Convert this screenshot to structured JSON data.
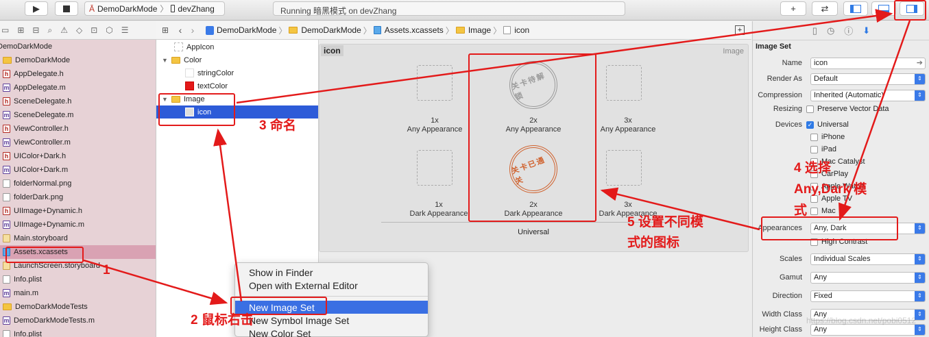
{
  "toolbar": {
    "scheme_app": "DemoDarkMode",
    "scheme_device": "devZhang",
    "status": "Running 暗黑模式 on devZhang"
  },
  "navigator": {
    "project": "DemoDarkMode",
    "group": "DemoDarkMode",
    "files": [
      {
        "name": "AppDelegate.h",
        "kind": "h"
      },
      {
        "name": "AppDelegate.m",
        "kind": "m"
      },
      {
        "name": "SceneDelegate.h",
        "kind": "h"
      },
      {
        "name": "SceneDelegate.m",
        "kind": "m"
      },
      {
        "name": "ViewController.h",
        "kind": "h"
      },
      {
        "name": "ViewController.m",
        "kind": "m"
      },
      {
        "name": "UIColor+Dark.h",
        "kind": "h"
      },
      {
        "name": "UIColor+Dark.m",
        "kind": "m"
      },
      {
        "name": "folderNormal.png",
        "kind": "img"
      },
      {
        "name": "folderDark.png",
        "kind": "img"
      },
      {
        "name": "UIImage+Dynamic.h",
        "kind": "h"
      },
      {
        "name": "UIImage+Dynamic.m",
        "kind": "m"
      },
      {
        "name": "Main.storyboard",
        "kind": "sb"
      },
      {
        "name": "Assets.xcassets",
        "kind": "xa"
      },
      {
        "name": "LaunchScreen.storyboard",
        "kind": "sb"
      },
      {
        "name": "Info.plist",
        "kind": "pl"
      },
      {
        "name": "main.m",
        "kind": "m"
      }
    ],
    "tests_group": "DemoDarkModeTests",
    "tests_file": "DemoDarkModeTests.m",
    "tests_plist": "Info.plist"
  },
  "jumpbar": {
    "crumbs": [
      "DemoDarkMode",
      "DemoDarkMode",
      "Assets.xcassets",
      "Image",
      "icon"
    ]
  },
  "assets": {
    "appicon": "AppIcon",
    "color_group": "Color",
    "string_color": "stringColor",
    "text_color": "textColor",
    "image_group": "Image",
    "icon": "icon"
  },
  "editor": {
    "set_name": "icon",
    "type_label": "Image",
    "slot_1x_any": "1x",
    "any_appearance": "Any Appearance",
    "slot_2x_any": "2x",
    "slot_3x_any": "3x",
    "dark_appearance": "Dark Appearance",
    "universal": "Universal",
    "stamp_any": "关卡待解锁",
    "stamp_dark": "关卡已通关"
  },
  "inspector": {
    "title": "Image Set",
    "name_label": "Name",
    "name_value": "icon",
    "render_label": "Render As",
    "render_value": "Default",
    "compression_label": "Compression",
    "compression_value": "Inherited (Automatic)",
    "resizing_label": "Resizing",
    "resizing_value": "Preserve Vector Data",
    "devices_label": "Devices",
    "devices": [
      "Universal",
      "iPhone",
      "iPad",
      "Mac Catalyst",
      "CarPlay",
      "Apple Watch",
      "Apple TV",
      "Mac"
    ],
    "appearances_label": "Appearances",
    "appearances_value": "Any, Dark",
    "high_contrast": "High Contrast",
    "scales_label": "Scales",
    "scales_value": "Individual Scales",
    "gamut_label": "Gamut",
    "gamut_value": "Any",
    "direction_label": "Direction",
    "direction_value": "Fixed",
    "width_label": "Width Class",
    "width_value": "Any",
    "height_label": "Height Class",
    "height_value": "Any",
    "watermark": "https://blog.csdn.net/pobi0512"
  },
  "context_menu": [
    "Show in Finder",
    "Open with External Editor",
    "New Image Set",
    "New Symbol Image Set",
    "New Color Set"
  ],
  "annotations": {
    "a1": "1",
    "a2": "2 鼠标右击",
    "a3": "3 命名",
    "a4_line1": "4 选择",
    "a4_line2": "Any,Dark 模",
    "a4_line3": "式",
    "a5_line1": "5 设置不同模",
    "a5_line2": "式的图标"
  },
  "colors": {
    "accent": "#2f7ae5",
    "annotation": "#e31a1a",
    "selection": "#2d5bd8",
    "text_color_swatch": "#e31a1a"
  }
}
